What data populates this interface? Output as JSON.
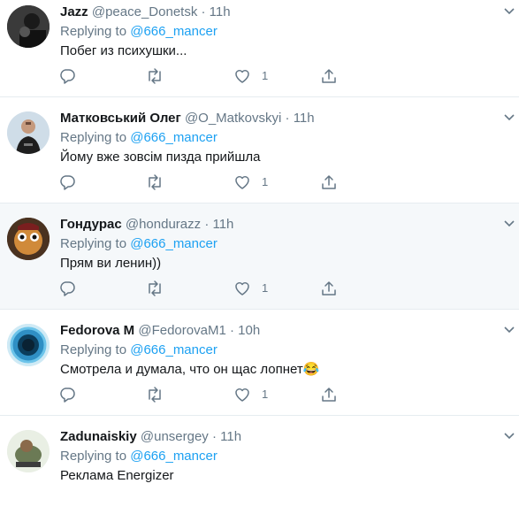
{
  "tweets": [
    {
      "name": "Jazz",
      "handle": "@peace_Donetsk",
      "dot": "·",
      "time": "11h",
      "reply_prefix": "Replying to",
      "reply_to": "@666_mancer",
      "text": "Побег из психушки...",
      "likes": "1"
    },
    {
      "name": "Матковський Олег",
      "handle": "@O_Matkovskyi",
      "dot": "·",
      "time": "11h",
      "reply_prefix": "Replying to",
      "reply_to": "@666_mancer",
      "text": "Йому вже зовсім пизда прийшла",
      "likes": "1"
    },
    {
      "name": "Гондурас",
      "handle": "@hondurazz",
      "dot": "·",
      "time": "11h",
      "reply_prefix": "Replying to",
      "reply_to": "@666_mancer",
      "text": "Прям ви ленин))",
      "likes": "1"
    },
    {
      "name": "Fedorova M",
      "handle": "@FedorovaM1",
      "dot": "·",
      "time": "10h",
      "reply_prefix": "Replying to",
      "reply_to": "@666_mancer",
      "text": "Смотрела и думала, что он щас лопнет😂",
      "likes": "1"
    },
    {
      "name": "Zadunaiskiy",
      "handle": "@unsergey",
      "dot": "·",
      "time": "11h",
      "reply_prefix": "Replying to",
      "reply_to": "@666_mancer",
      "text": "Реклама Energizer",
      "likes": ""
    }
  ],
  "icons": {
    "reply": "reply-icon",
    "retweet": "retweet-icon",
    "like": "heart-icon",
    "share": "share-icon",
    "menu": "chevron-down-icon"
  },
  "colors": {
    "link": "#1da1f2",
    "secondary": "#657786",
    "highlight": "#f5f8fa",
    "divider": "#e6ecf0"
  }
}
